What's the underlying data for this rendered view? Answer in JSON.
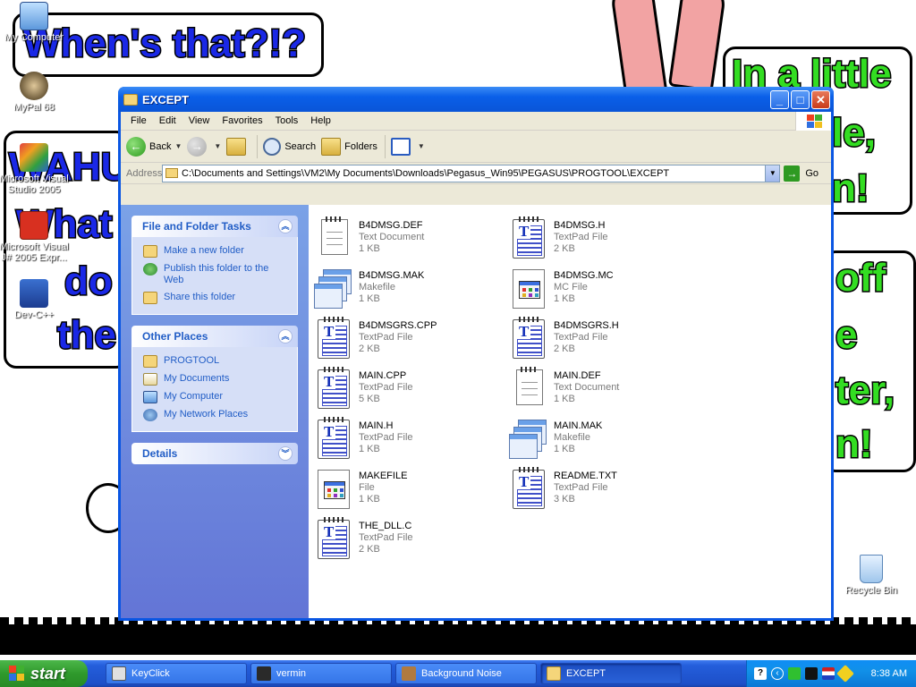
{
  "desktop": {
    "icons": [
      {
        "label": "My Computer"
      },
      {
        "label": "MyPal 68"
      },
      {
        "label": "Microsoft Visual Studio 2005"
      },
      {
        "label": "Microsoft Visual J# 2005 Expr..."
      },
      {
        "label": "Dev-C++"
      },
      {
        "label": "Recycle Bin"
      }
    ],
    "wallpaper": {
      "speech_top": "When's that?!?",
      "speech_left_1": "WAHU",
      "speech_left_2": "What",
      "speech_left_3": "do",
      "speech_left_4": "the",
      "speech_right_1": "In a little",
      "speech_right_2": "le,",
      "speech_right_3": "n!",
      "speech_right_4": "off",
      "speech_right_5": "e",
      "speech_right_6": "ter,",
      "speech_right_7": "n!"
    }
  },
  "window": {
    "title": "EXCEPT",
    "menu": [
      "File",
      "Edit",
      "View",
      "Favorites",
      "Tools",
      "Help"
    ],
    "toolbar": {
      "back_label": "Back",
      "search_label": "Search",
      "folders_label": "Folders"
    },
    "address": {
      "label": "Address",
      "path": "C:\\Documents and Settings\\VM2\\My Documents\\Downloads\\Pegasus_Win95\\PEGASUS\\PROGTOOL\\EXCEPT",
      "go_label": "Go"
    },
    "tasks": {
      "file_folder": {
        "title": "File and Folder Tasks",
        "items": [
          "Make a new folder",
          "Publish this folder to the Web",
          "Share this folder"
        ]
      },
      "other_places": {
        "title": "Other Places",
        "items": [
          "PROGTOOL",
          "My Documents",
          "My Computer",
          "My Network Places"
        ]
      },
      "details": {
        "title": "Details"
      }
    },
    "files": [
      {
        "name": "B4DMSG.DEF",
        "type": "Text Document",
        "size": "1 KB",
        "icon": "text-document-icon"
      },
      {
        "name": "B4DMSG.H",
        "type": "TextPad File",
        "size": "2 KB",
        "icon": "textpad-file-icon"
      },
      {
        "name": "B4DMSG.MAK",
        "type": "Makefile",
        "size": "1 KB",
        "icon": "makefile-icon"
      },
      {
        "name": "B4DMSG.MC",
        "type": "MC File",
        "size": "1 KB",
        "icon": "generic-file-icon"
      },
      {
        "name": "B4DMSGRS.CPP",
        "type": "TextPad File",
        "size": "2 KB",
        "icon": "textpad-file-icon"
      },
      {
        "name": "B4DMSGRS.H",
        "type": "TextPad File",
        "size": "2 KB",
        "icon": "textpad-file-icon"
      },
      {
        "name": "MAIN.CPP",
        "type": "TextPad File",
        "size": "5 KB",
        "icon": "textpad-file-icon"
      },
      {
        "name": "MAIN.DEF",
        "type": "Text Document",
        "size": "1 KB",
        "icon": "text-document-icon"
      },
      {
        "name": "MAIN.H",
        "type": "TextPad File",
        "size": "1 KB",
        "icon": "textpad-file-icon"
      },
      {
        "name": "MAIN.MAK",
        "type": "Makefile",
        "size": "1 KB",
        "icon": "makefile-icon"
      },
      {
        "name": "MAKEFILE",
        "type": "File",
        "size": "1 KB",
        "icon": "generic-file-icon"
      },
      {
        "name": "README.TXT",
        "type": "TextPad File",
        "size": "3 KB",
        "icon": "textpad-file-icon"
      },
      {
        "name": "THE_DLL.C",
        "type": "TextPad File",
        "size": "2 KB",
        "icon": "textpad-file-icon"
      }
    ]
  },
  "taskbar": {
    "start_label": "start",
    "buttons": [
      {
        "label": "KeyClick",
        "active": false
      },
      {
        "label": "vermin",
        "active": false
      },
      {
        "label": "Background Noise",
        "active": false
      },
      {
        "label": "EXCEPT",
        "active": true
      }
    ],
    "clock": "8:38 AM"
  },
  "colors": {
    "title_blue": "#0a5fe8",
    "task_pane_blue": "#6375d6",
    "task_link": "#215dc6",
    "start_green": "#2f9a2c",
    "wallpaper_text_blue": "#1a28e6",
    "wallpaper_text_green": "#33dd22"
  }
}
